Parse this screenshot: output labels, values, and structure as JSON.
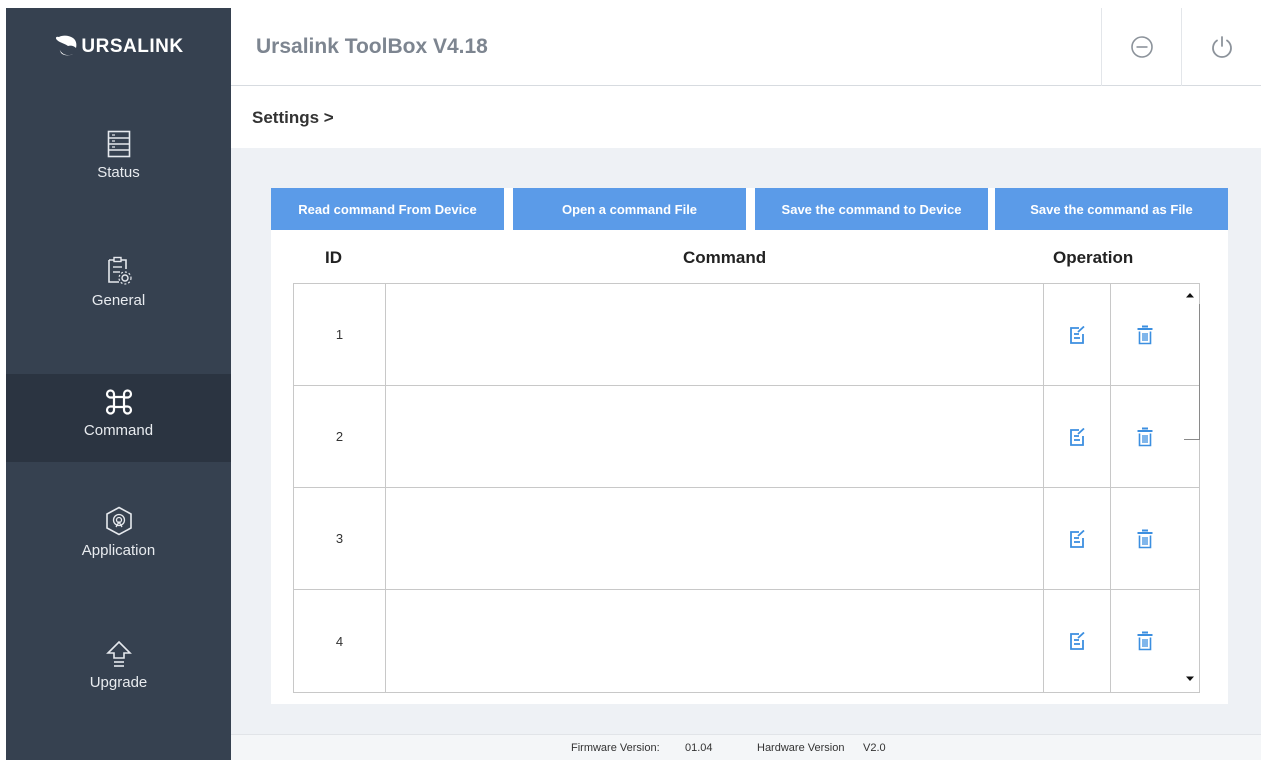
{
  "app": {
    "logo_text": "URSALINK",
    "title": "Ursalink ToolBox V4.18"
  },
  "header": {
    "minimize_icon": "minus-circle-icon",
    "power_icon": "power-icon"
  },
  "sidebar": {
    "items": [
      {
        "label": "Status",
        "icon": "status-list-icon",
        "active": false
      },
      {
        "label": "General",
        "icon": "general-settings-icon",
        "active": false
      },
      {
        "label": "Command",
        "icon": "command-key-icon",
        "active": true
      },
      {
        "label": "Application",
        "icon": "application-hex-icon",
        "active": false
      },
      {
        "label": "Upgrade",
        "icon": "upgrade-arrow-icon",
        "active": false
      }
    ]
  },
  "breadcrumb": "Settings >",
  "actions": {
    "read_label": "Read command From Device",
    "open_label": "Open a command File",
    "save_device_label": "Save the command to Device",
    "save_file_label": "Save the command as File"
  },
  "table": {
    "headers": {
      "id": "ID",
      "command": "Command",
      "operation": "Operation"
    },
    "rows": [
      {
        "id": "1",
        "command": ""
      },
      {
        "id": "2",
        "command": ""
      },
      {
        "id": "3",
        "command": ""
      },
      {
        "id": "4",
        "command": ""
      }
    ]
  },
  "footer": {
    "firmware_label": "Firmware Version:",
    "firmware_value": "01.04",
    "hardware_label": "Hardware Version",
    "hardware_value": "V2.0"
  },
  "colors": {
    "sidebar_bg": "#364150",
    "sidebar_active": "#2b3441",
    "accent_button": "#5b9be8",
    "icon_blue": "#3c8fe0",
    "content_bg": "#eef1f5"
  }
}
